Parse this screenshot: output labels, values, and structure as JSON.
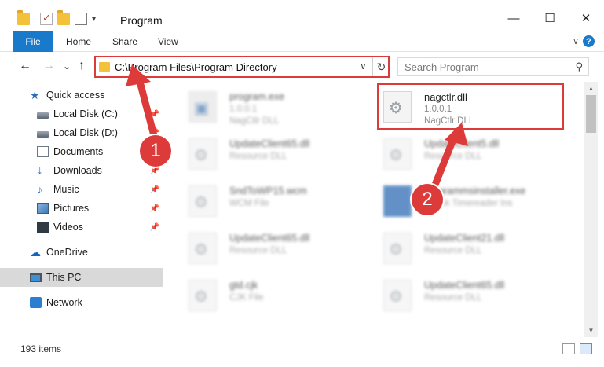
{
  "window": {
    "title": "Program",
    "minimize": "—",
    "maximize": "☐",
    "close": "✕"
  },
  "ribbon": {
    "file": "File",
    "home": "Home",
    "share": "Share",
    "view": "View",
    "help": "?",
    "collapse": "∨"
  },
  "nav": {
    "back": "←",
    "forward": "→",
    "recent": "⌄",
    "up": "↑"
  },
  "address": {
    "path": "C:\\Program Files\\Program Directory",
    "dropdown": "∨",
    "refresh": "↻"
  },
  "search": {
    "placeholder": "Search Program",
    "icon": "⚲"
  },
  "sidebar": {
    "items": [
      {
        "label": "Quick access",
        "icon": "star-icon",
        "pinned": false
      },
      {
        "label": "Local Disk (C:)",
        "icon": "drive-icon",
        "pinned": true
      },
      {
        "label": "Local Disk (D:)",
        "icon": "drive-icon",
        "pinned": true
      },
      {
        "label": "Documents",
        "icon": "documents-icon",
        "pinned": true
      },
      {
        "label": "Downloads",
        "icon": "downloads-icon",
        "pinned": true
      },
      {
        "label": "Music",
        "icon": "music-icon",
        "pinned": true
      },
      {
        "label": "Pictures",
        "icon": "pictures-icon",
        "pinned": true
      },
      {
        "label": "Videos",
        "icon": "videos-icon",
        "pinned": true
      },
      {
        "label": "OneDrive",
        "icon": "cloud-icon",
        "pinned": false
      },
      {
        "label": "This PC",
        "icon": "pc-icon",
        "pinned": false,
        "selected": true
      },
      {
        "label": "Network",
        "icon": "network-icon",
        "pinned": false
      }
    ],
    "pin_glyph": "📌"
  },
  "files": [
    {
      "name": "program.exe",
      "line2": "1.0.0.1",
      "line3": "NagCtlr DLL",
      "blurred": true,
      "icon": "exe-icon"
    },
    {
      "name": "nagctlr.dll",
      "line2": "1.0.0.1",
      "line3": "NagCtlr DLL",
      "blurred": false,
      "icon": "dll-icon"
    },
    {
      "name": "UpdateClient65.dll",
      "line2": "Resource DLL",
      "line3": "",
      "blurred": true,
      "icon": "dll-icon"
    },
    {
      "name": "UpdateClient5.dll",
      "line2": "Resource DLL",
      "line3": "",
      "blurred": true,
      "icon": "dll-icon"
    },
    {
      "name": "SndToWP15.wcm",
      "line2": "WCM File",
      "line3": "",
      "blurred": true,
      "icon": "file-icon"
    },
    {
      "name": "programmsinstaller.exe",
      "line2": "Ebook Timereader Ins",
      "line3": "",
      "blurred": true,
      "icon": "installer-icon"
    },
    {
      "name": "UpdateClient65.dll",
      "line2": "Resource DLL",
      "line3": "",
      "blurred": true,
      "icon": "dll-icon"
    },
    {
      "name": "UpdateClient21.dll",
      "line2": "Resource DLL",
      "line3": "",
      "blurred": true,
      "icon": "dll-icon"
    },
    {
      "name": "gtd.cjk",
      "line2": "CJK File",
      "line3": "",
      "blurred": true,
      "icon": "file-icon"
    },
    {
      "name": "UpdateClient65.dll",
      "line2": "Resource DLL",
      "line3": "",
      "blurred": true,
      "icon": "dll-icon"
    }
  ],
  "annotations": {
    "step1": "1",
    "step2": "2",
    "color": "#dd3a3a"
  },
  "status": {
    "count": "193 items"
  }
}
